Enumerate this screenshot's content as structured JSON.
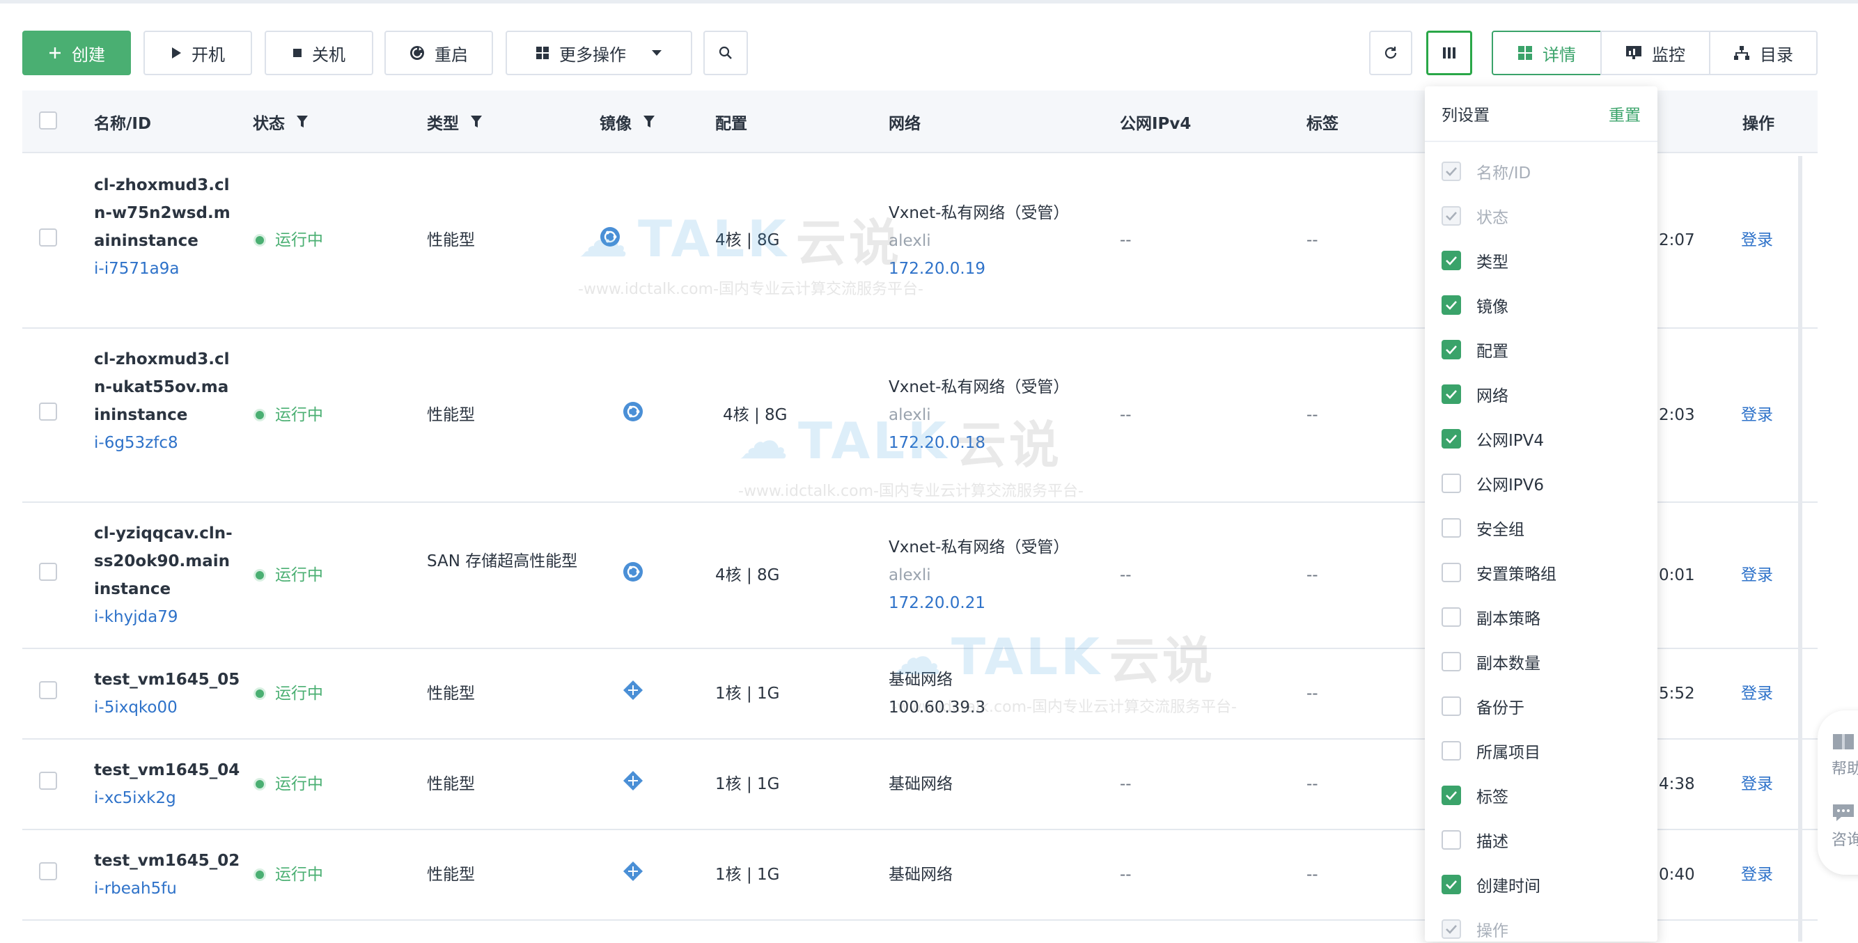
{
  "toolbar": {
    "create": "创建",
    "start": "开机",
    "stop": "关机",
    "restart": "重启",
    "more": "更多操作",
    "view_details": "详情",
    "view_monitor": "监控",
    "view_catalog": "目录"
  },
  "table": {
    "headers": {
      "name": "名称/ID",
      "status": "状态",
      "type": "类型",
      "image": "镜像",
      "config": "配置",
      "network": "网络",
      "ipv4": "公网IPv4",
      "tags": "标签",
      "ops": "操作"
    },
    "rows": [
      {
        "name": "cl-zhoxmud3.cln-w75n2wsd.maininstance",
        "id": "i-i7571a9a",
        "status": "运行中",
        "type": "性能型",
        "config": "4核 | 8G",
        "net_name": "Vxnet-私有网络（受管）",
        "net_owner": "alexli",
        "net_ip": "172.20.0.19",
        "ipv4": "--",
        "tags": "--",
        "time": "2:07",
        "op": "登录"
      },
      {
        "name": "cl-zhoxmud3.cln-ukat55ov.maininstance",
        "id": "i-6g53zfc8",
        "status": "运行中",
        "type": "性能型",
        "config": "4核 | 8G",
        "net_name": "Vxnet-私有网络（受管）",
        "net_owner": "alexli",
        "net_ip": "172.20.0.18",
        "ipv4": "--",
        "tags": "--",
        "time": "2:03",
        "op": "登录"
      },
      {
        "name": "cl-yziqqcav.cln-ss20ok90.maininstance",
        "id": "i-khyjda79",
        "status": "运行中",
        "type": "SAN 存储超高性能型",
        "config": "4核 | 8G",
        "net_name": "Vxnet-私有网络（受管）",
        "net_owner": "alexli",
        "net_ip": "172.20.0.21",
        "ipv4": "--",
        "tags": "--",
        "time": "0:01",
        "op": "登录"
      },
      {
        "name": "test_vm1645_05",
        "id": "i-5ixqko00",
        "status": "运行中",
        "type": "性能型",
        "config": "1核 | 1G",
        "net_name": "基础网络",
        "net_ip2": "100.60.39.3",
        "ipv4": "--",
        "tags": "--",
        "time": "5:52",
        "op": "登录"
      },
      {
        "name": "test_vm1645_04",
        "id": "i-xc5ixk2g",
        "status": "运行中",
        "type": "性能型",
        "config": "1核 | 1G",
        "net_name": "基础网络",
        "ipv4": "--",
        "tags": "--",
        "time": "4:38",
        "op": "登录"
      },
      {
        "name": "test_vm1645_02",
        "id": "i-rbeah5fu",
        "status": "运行中",
        "type": "性能型",
        "config": "1核 | 1G",
        "net_name": "基础网络",
        "ipv4": "--",
        "tags": "--",
        "time": "0:40",
        "op": "登录"
      }
    ]
  },
  "column_settings": {
    "title": "列设置",
    "reset": "重置",
    "options": [
      {
        "label": "名称/ID",
        "state": "disabled"
      },
      {
        "label": "状态",
        "state": "disabled"
      },
      {
        "label": "类型",
        "state": "on"
      },
      {
        "label": "镜像",
        "state": "on"
      },
      {
        "label": "配置",
        "state": "on"
      },
      {
        "label": "网络",
        "state": "on"
      },
      {
        "label": "公网IPV4",
        "state": "on"
      },
      {
        "label": "公网IPV6",
        "state": "off"
      },
      {
        "label": "安全组",
        "state": "off"
      },
      {
        "label": "安置策略组",
        "state": "off"
      },
      {
        "label": "副本策略",
        "state": "off"
      },
      {
        "label": "副本数量",
        "state": "off"
      },
      {
        "label": "备份于",
        "state": "off"
      },
      {
        "label": "所属项目",
        "state": "off"
      },
      {
        "label": "标签",
        "state": "on"
      },
      {
        "label": "描述",
        "state": "off"
      },
      {
        "label": "创建时间",
        "state": "on"
      },
      {
        "label": "操作",
        "state": "disabled"
      }
    ]
  },
  "watermark": {
    "brand": "TALK",
    "brand_cn": "云说",
    "url": "-www.idctalk.com-国内专业云计算交流服务平台-"
  },
  "float": {
    "help": "帮助",
    "consult": "咨询"
  },
  "colors": {
    "primary": "#4aaf72",
    "link": "#2e72c9",
    "accent_green": "#3aa36a"
  }
}
